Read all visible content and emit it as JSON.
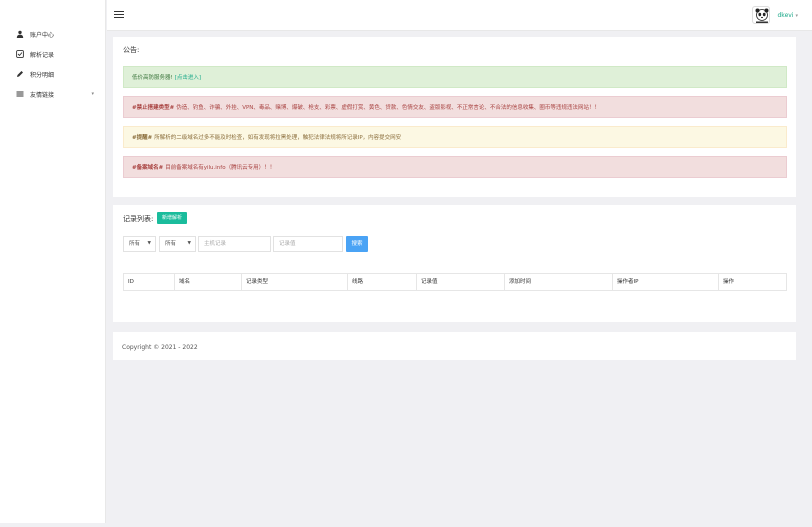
{
  "sidebar": {
    "items": [
      {
        "label": "账户中心",
        "icon": "user-icon"
      },
      {
        "label": "解析记录",
        "icon": "check-square-icon"
      },
      {
        "label": "积分明细",
        "icon": "pencil-icon"
      },
      {
        "label": "友情链接",
        "icon": "list-icon",
        "caret": "▾"
      }
    ]
  },
  "header": {
    "username": "dkevi",
    "dropdown": "▾"
  },
  "notice": {
    "title": "公告:",
    "green": {
      "text": "低价高防服务器!",
      "link": "[点击进入]"
    },
    "red1": {
      "tag": "#禁止搭建类型#",
      "text": "伪造、钓鱼、诈骗、外挂、VPN、毒品、赌博、爆破、枪支、彩票、虚假打赏、黄色、贷款、色情交友、盗版影视、不正常言论、不合法的信息收集、圈币等违规违法网站！！"
    },
    "yellow": {
      "tag": "#提醒#",
      "text": "所解析的二级域名过多不能及时检查，如有发现将拉黑处理，触犯法律法规将所记录IP，内容提交网安"
    },
    "red2": {
      "tag": "#备案域名#",
      "text": "目前备案域名有yilu.info（腾讯云专用）！！"
    }
  },
  "records": {
    "title": "记录列表:",
    "new_button": "新增解析",
    "filter1": "所有",
    "filter2": "所有",
    "host_placeholder": "主机记录",
    "value_placeholder": "记录值",
    "search_button": "搜索",
    "columns": [
      "ID",
      "域名",
      "记录类型",
      "线路",
      "记录值",
      "添加时间",
      "操作者IP",
      "操作"
    ]
  },
  "footer": {
    "copyright": "Copyright © 2021 - 2022"
  }
}
